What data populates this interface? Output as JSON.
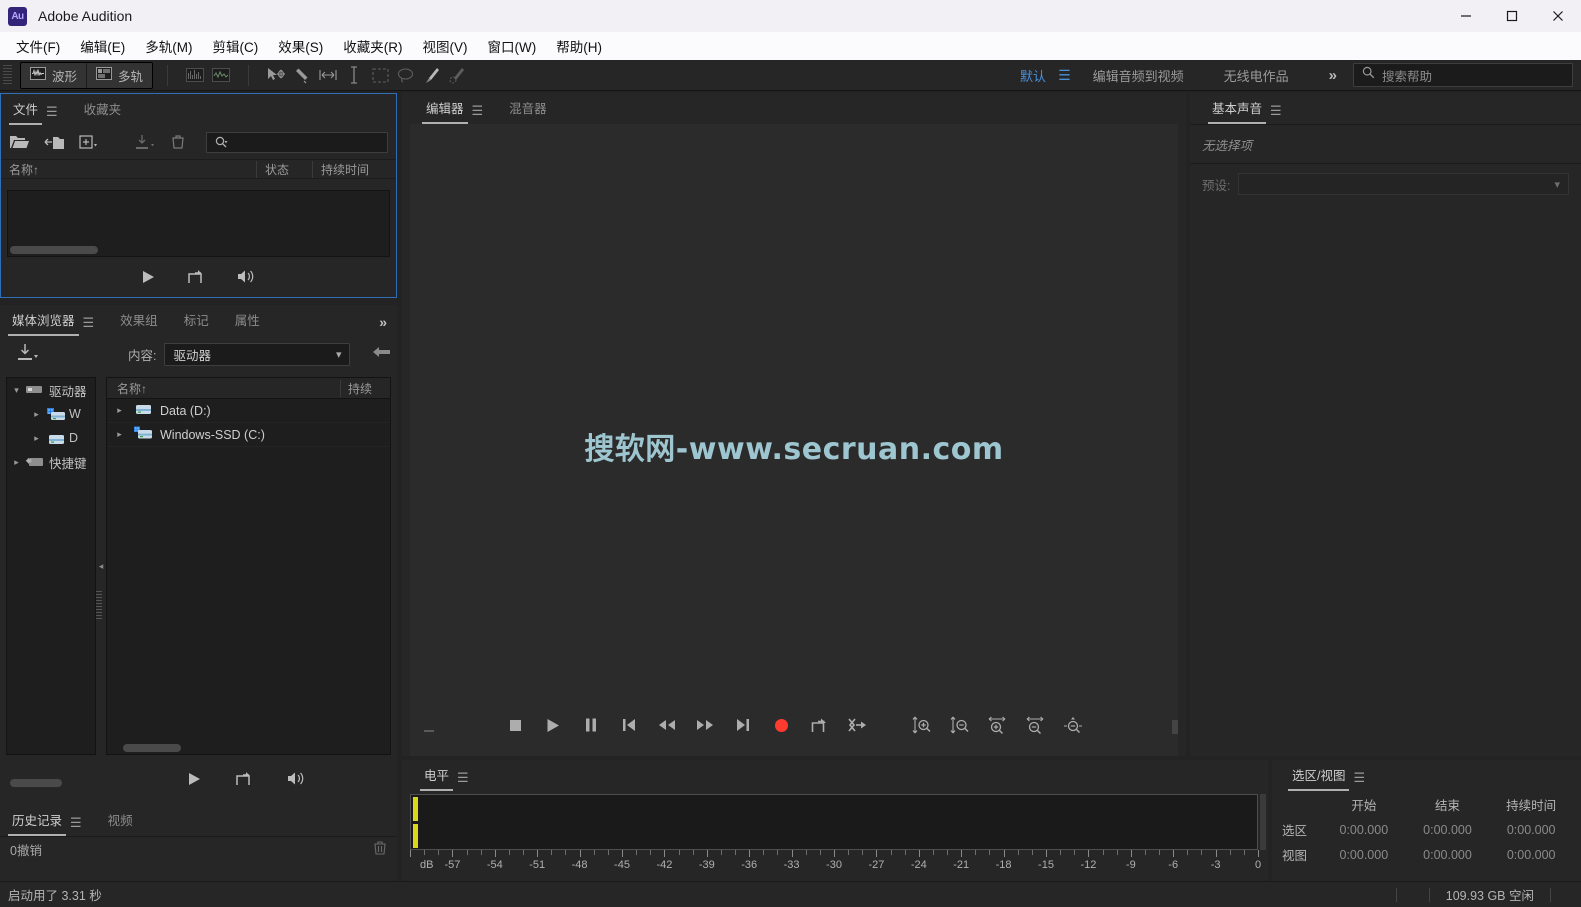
{
  "window": {
    "title": "Adobe Audition",
    "logo_text": "Au",
    "controls": [
      {
        "name": "minimize",
        "glyph": "minimize-icon"
      },
      {
        "name": "maximize",
        "glyph": "maximize-icon"
      },
      {
        "name": "close",
        "glyph": "close-icon"
      }
    ]
  },
  "menubar": {
    "items": [
      {
        "label": "文件(F)"
      },
      {
        "label": "编辑(E)"
      },
      {
        "label": "多轨(M)"
      },
      {
        "label": "剪辑(C)"
      },
      {
        "label": "效果(S)"
      },
      {
        "label": "收藏夹(R)"
      },
      {
        "label": "视图(V)"
      },
      {
        "label": "窗口(W)"
      },
      {
        "label": "帮助(H)"
      }
    ]
  },
  "toolbar": {
    "waveform_label": "波形",
    "multitrack_label": "多轨",
    "workspace_default": "默认",
    "workspace_items": [
      "编辑音频到视频",
      "无线电作品"
    ],
    "more_label": "»",
    "search_placeholder": "搜索帮助",
    "accent_color": "#4a90d9"
  },
  "files_panel": {
    "tabs": [
      {
        "label": "文件",
        "active": true
      },
      {
        "label": "收藏夹",
        "active": false
      }
    ],
    "columns": [
      "名称",
      "状态",
      "持续时间"
    ],
    "sort_glyph": "↑",
    "rows": []
  },
  "media_panel": {
    "tabs": [
      {
        "label": "媒体浏览器",
        "active": true
      },
      {
        "label": "效果组",
        "active": false
      },
      {
        "label": "标记",
        "active": false
      },
      {
        "label": "属性",
        "active": false
      }
    ],
    "more_label": "»",
    "contents_label": "内容:",
    "contents_value": "驱动器",
    "tree": [
      {
        "label": "驱动器",
        "indent": 0,
        "expanded": true
      },
      {
        "label": "W",
        "indent": 1,
        "expanded": false
      },
      {
        "label": "D",
        "indent": 1,
        "expanded": false
      },
      {
        "label": "快捷键",
        "indent": 0,
        "expanded": false
      }
    ],
    "columns": [
      "名称",
      "持续"
    ],
    "sort_glyph": "↑",
    "rows": [
      {
        "name": "Data (D:)",
        "duration": ""
      },
      {
        "name": "Windows-SSD (C:)",
        "duration": ""
      }
    ]
  },
  "history_panel": {
    "tabs": [
      {
        "label": "历史记录",
        "active": true
      },
      {
        "label": "视频",
        "active": false
      }
    ],
    "entry": "0撤销"
  },
  "editor_panel": {
    "tabs": [
      {
        "label": "编辑器",
        "active": true
      },
      {
        "label": "混音器",
        "active": false
      }
    ],
    "watermark": "搜软网-www.secruan.com",
    "transport": [
      {
        "name": "stop-button",
        "glyph": "stop-icon"
      },
      {
        "name": "play-button",
        "glyph": "play-icon"
      },
      {
        "name": "pause-button",
        "glyph": "pause-icon"
      },
      {
        "name": "move-playhead-to-previous-button",
        "glyph": "skip-back-icon"
      },
      {
        "name": "rewind-button",
        "glyph": "rewind-icon"
      },
      {
        "name": "fast-forward-button",
        "glyph": "fast-forward-icon"
      },
      {
        "name": "move-playhead-to-next-button",
        "glyph": "skip-forward-icon"
      },
      {
        "name": "record-button",
        "glyph": "record-icon"
      },
      {
        "name": "loop-playback-button",
        "glyph": "loop-icon"
      },
      {
        "name": "skip-selection-button",
        "glyph": "skip-selection-icon"
      },
      {
        "name": "zoom-in-amplitude-button",
        "glyph": "zoom-in-vertical-icon"
      },
      {
        "name": "zoom-out-amplitude-button",
        "glyph": "zoom-out-vertical-icon"
      },
      {
        "name": "zoom-in-time-button",
        "glyph": "zoom-in-horizontal-icon"
      },
      {
        "name": "zoom-out-time-button",
        "glyph": "zoom-out-horizontal-icon"
      },
      {
        "name": "zoom-out-full-button",
        "glyph": "zoom-full-icon"
      }
    ]
  },
  "essential_sound_panel": {
    "tabs": [
      {
        "label": "基本声音",
        "active": true
      }
    ],
    "no_selection": "无选择项",
    "preset_label": "预设:",
    "preset_value": ""
  },
  "levels_panel": {
    "tabs": [
      {
        "label": "电平",
        "active": true
      }
    ],
    "scale_unit": "dB",
    "scale_labels": [
      "-57",
      "-54",
      "-51",
      "-48",
      "-45",
      "-42",
      "-39",
      "-36",
      "-33",
      "-30",
      "-27",
      "-24",
      "-21",
      "-18",
      "-15",
      "-12",
      "-9",
      "-6",
      "-3",
      "0"
    ],
    "scale_min": -60,
    "scale_max": 0,
    "meter_color": "#d9d917"
  },
  "selection_view_panel": {
    "tabs": [
      {
        "label": "选区/视图",
        "active": true
      }
    ],
    "headers": [
      "开始",
      "结束",
      "持续时间"
    ],
    "rows": [
      {
        "label": "选区",
        "start": "0:00.000",
        "end": "0:00.000",
        "duration": "0:00.000"
      },
      {
        "label": "视图",
        "start": "0:00.000",
        "end": "0:00.000",
        "duration": "0:00.000"
      }
    ]
  },
  "statusbar": {
    "left": "启动用了 3.31 秒",
    "right": "109.93 GB 空闲"
  }
}
